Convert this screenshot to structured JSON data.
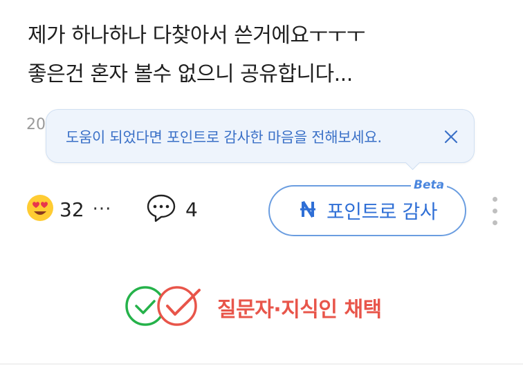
{
  "post": {
    "line1": "제가 하나하나 다찾아서 쓴거에요ㅜㅜㅜ",
    "line2": "좋은건 혼자 볼수 없으니 공유합니다..."
  },
  "date_stub": "20",
  "tooltip": {
    "text": "도움이 되었다면 포인트로 감사한 마음을 전해보세요."
  },
  "reaction": {
    "emoji": "😍",
    "count": "32",
    "more": "···"
  },
  "comment": {
    "count": "4"
  },
  "point_button": {
    "label": "포인트로 감사",
    "beta": "Beta"
  },
  "adopt": {
    "label": "질문자·지식인 채택"
  },
  "colors": {
    "tooltip_text": "#3a70c7",
    "point_blue": "#2f6fd6",
    "adopt_green": "#25b24a",
    "adopt_red": "#e8554a"
  },
  "icons": [
    "close-icon",
    "heart-eyes-emoji-icon",
    "more-dots-icon",
    "comment-bubble-icon",
    "point-n-icon",
    "kebab-menu-icon",
    "adopt-check-green-icon",
    "adopt-check-red-icon"
  ]
}
